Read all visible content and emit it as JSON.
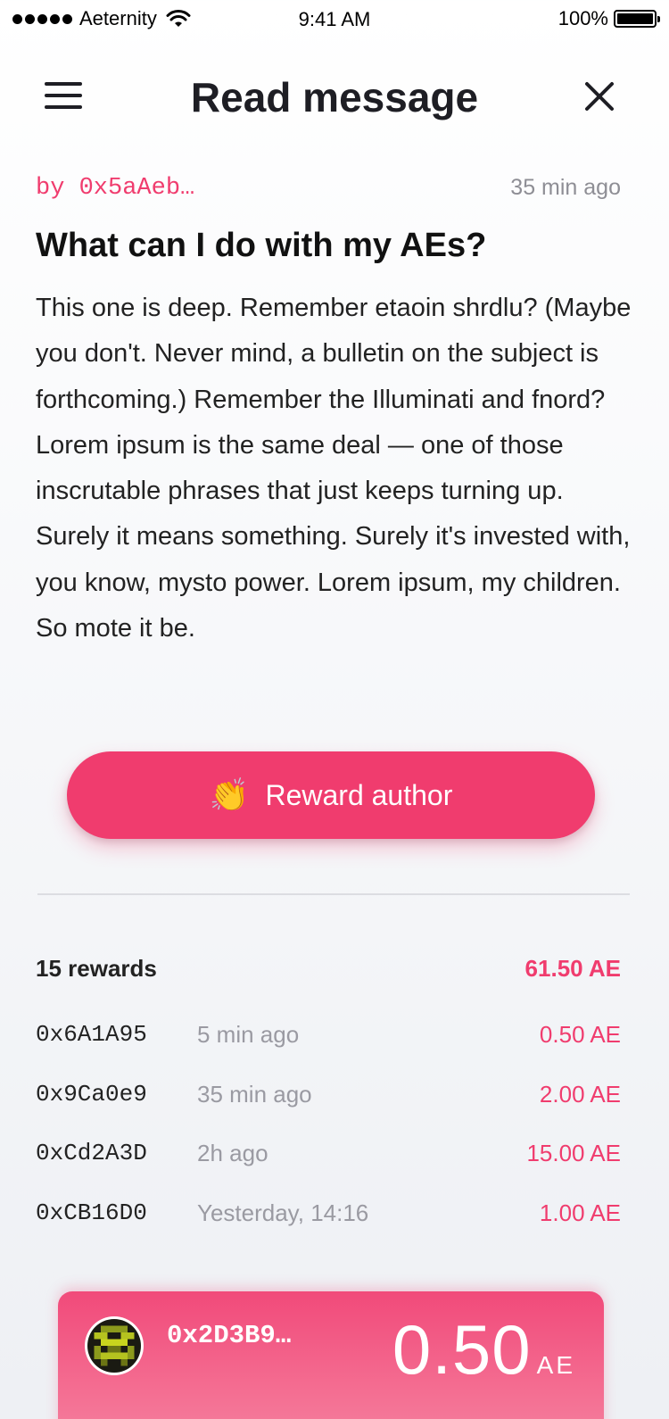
{
  "status_bar": {
    "carrier": "Aeternity",
    "time": "9:41 AM",
    "battery": "100%"
  },
  "nav": {
    "title": "Read message",
    "menu_icon": "hamburger-menu-icon",
    "close_icon": "close-icon"
  },
  "message": {
    "author": "by 0x5aAeb…",
    "time_ago": "35 min ago",
    "title": "What can I do with my AEs?",
    "body": "This one is deep. Remember etaoin shrdlu? (Maybe you don't. Never mind, a bulletin on the subject is forthcoming.) Remember the Illuminati and fnord? Lorem ipsum is the same deal — one of those inscrutable phrases that just keeps turning up. Surely it means something. Surely it's invested with, you know, mysto power. Lorem ipsum, my children. So mote it be."
  },
  "reward_button": {
    "icon": "👏",
    "label": "Reward author"
  },
  "rewards": {
    "count_label": "15 rewards",
    "total": "61.50 AE",
    "items": [
      {
        "address": "0x6A1A95",
        "time": "5 min ago",
        "amount": "0.50 AE"
      },
      {
        "address": "0x9Ca0e9",
        "time": "35 min ago",
        "amount": "2.00 AE"
      },
      {
        "address": "0xCd2A3D",
        "time": "2h ago",
        "amount": "15.00 AE"
      },
      {
        "address": "0xCB16D0",
        "time": "Yesterday, 14:16",
        "amount": "1.00 AE"
      }
    ]
  },
  "account": {
    "address": "0x2D3B9…",
    "balance": "0.50",
    "unit": "AE"
  },
  "colors": {
    "accent": "#f03c6e",
    "text": "#1e1e24",
    "muted": "#8e8e95"
  }
}
